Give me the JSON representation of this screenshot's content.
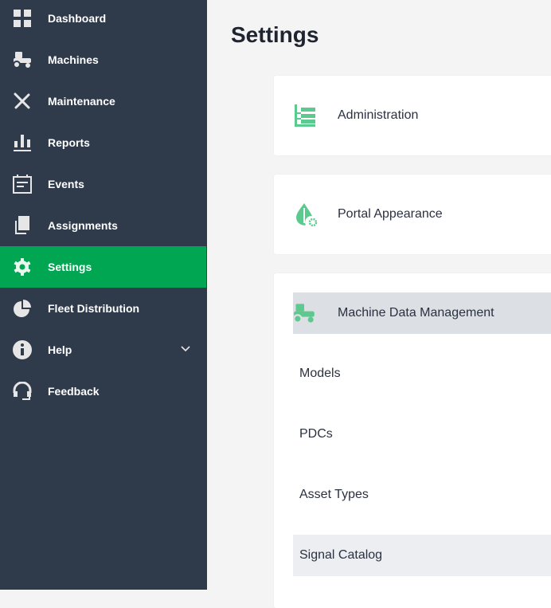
{
  "sidebar": {
    "items": [
      {
        "label": "Dashboard",
        "icon": "dashboard-icon"
      },
      {
        "label": "Machines",
        "icon": "tractor-icon"
      },
      {
        "label": "Maintenance",
        "icon": "tools-icon"
      },
      {
        "label": "Reports",
        "icon": "bar-chart-icon"
      },
      {
        "label": "Events",
        "icon": "calendar-icon"
      },
      {
        "label": "Assignments",
        "icon": "documents-icon"
      },
      {
        "label": "Settings",
        "icon": "gear-icon",
        "active": true
      },
      {
        "label": "Fleet Distribution",
        "icon": "pie-chart-icon"
      },
      {
        "label": "Help",
        "icon": "info-icon"
      },
      {
        "label": "Feedback",
        "icon": "headset-icon"
      }
    ]
  },
  "main": {
    "title": "Settings",
    "cards": [
      {
        "label": "Administration"
      },
      {
        "label": "Portal Appearance"
      },
      {
        "label": "Machine Data Management"
      }
    ],
    "sub_items": [
      "Models",
      "PDCs",
      "Asset Types",
      "Signal Catalog"
    ]
  },
  "colors": {
    "sidebar": "#2f3a4a",
    "active": "#00a651",
    "accent_icon": "#5cc98f"
  }
}
